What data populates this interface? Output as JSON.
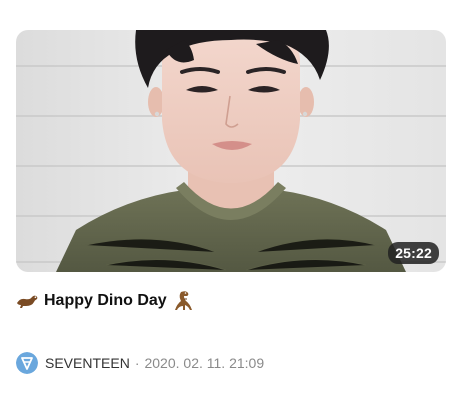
{
  "video": {
    "duration": "25:22",
    "title": "Happy Dino Day",
    "channel": "SEVENTEEN",
    "separator": "·",
    "date": "2020. 02. 11. 21:09"
  },
  "icons": {
    "title_left": "dinosaur-icon",
    "title_right": "t-rex-icon",
    "channel": "channel-logo"
  },
  "colors": {
    "thumbnail_bg": "#e6e6e6",
    "duration_bg": "#212121",
    "title_text": "#111111",
    "meta_text": "#8a8a8a",
    "channel_logo": "#6aa7dd"
  }
}
